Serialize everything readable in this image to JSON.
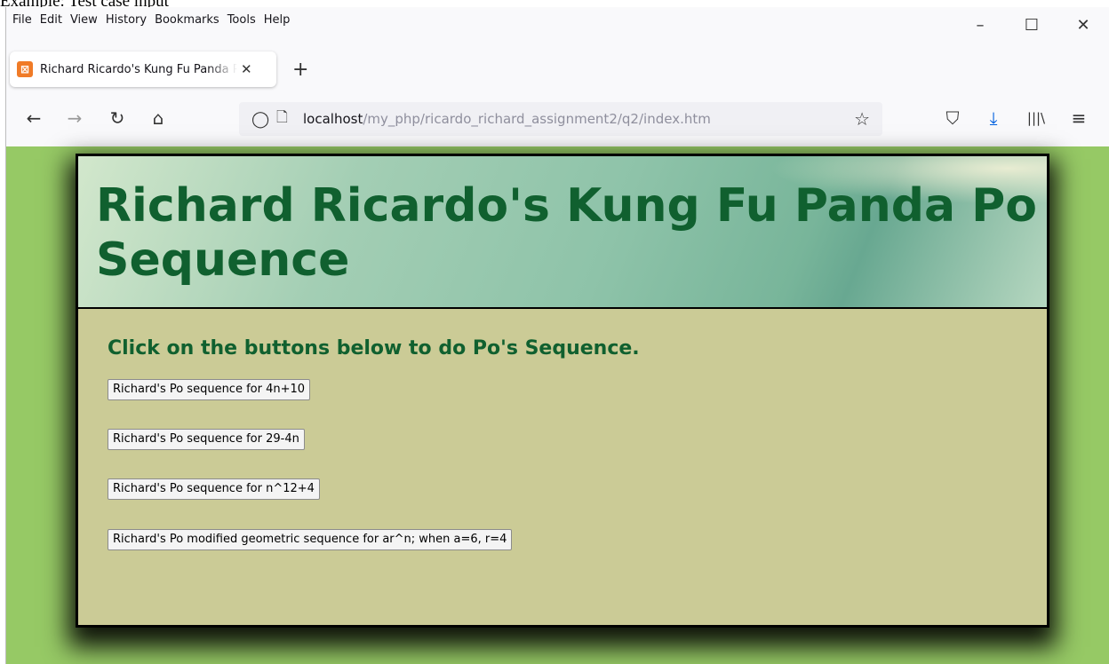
{
  "caption": "Example: Test case input",
  "menubar": {
    "items": [
      "File",
      "Edit",
      "View",
      "History",
      "Bookmarks",
      "Tools",
      "Help"
    ]
  },
  "window_controls": {
    "minimize": "–",
    "maximize": "☐",
    "close": "✕"
  },
  "tab": {
    "title": "Richard Ricardo's Kung Fu Panda Po Sequence",
    "favicon": "xampp-icon",
    "favicon_glyph": "⊠",
    "close": "✕"
  },
  "new_tab_label": "+",
  "navbar": {
    "back": "←",
    "forward": "→",
    "reload": "↻",
    "home": "⌂",
    "shield": "◯",
    "page_icon": "🗋",
    "url_host": "localhost",
    "url_path": "/my_php/ricardo_richard_assignment2/q2/index.htm",
    "bookmark_star": "☆",
    "pocket": "⛉",
    "downloads": "⤓",
    "library": "|||\\",
    "menu": "≡"
  },
  "page": {
    "title": "Richard Ricardo's Kung Fu Panda Po Sequence",
    "instructions": "Click on the buttons below to do Po's Sequence.",
    "buttons": [
      "Richard's Po sequence for 4n+10",
      "Richard's Po sequence for 29-4n",
      "Richard's Po sequence for n^12+4",
      "Richard's Po modified geometric sequence for ar^n; when a=6, r=4"
    ]
  },
  "colors": {
    "page_background": "#96c965",
    "content_background": "#cbcb96",
    "heading_text": "#10602f",
    "downloads_accent": "#0060df"
  }
}
